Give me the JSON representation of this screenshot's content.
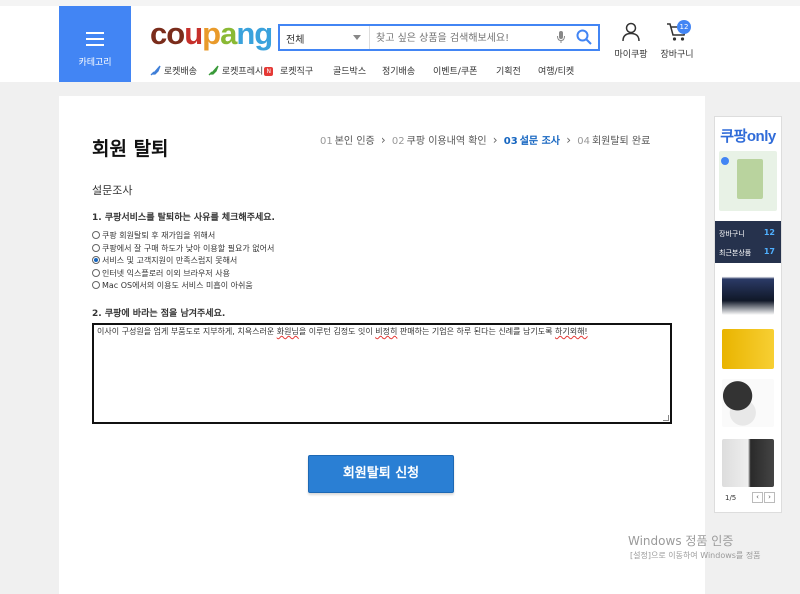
{
  "header": {
    "category_label": "카테고리",
    "logo": {
      "p1": "co",
      "p2": "u",
      "p3": "p",
      "p4": "a",
      "p5": "ng"
    },
    "search": {
      "category": "전체",
      "placeholder": "찾고 싶은 상품을 검색해보세요!"
    },
    "my_coupang": "마이쿠팡",
    "cart": "장바구니",
    "cart_count": "12",
    "nav": [
      "로켓배송",
      "로켓프레시",
      "로켓직구",
      "골드박스",
      "정기배송",
      "이벤트/쿠폰",
      "기획전",
      "여행/티켓"
    ],
    "nav_new_badge": "N"
  },
  "main": {
    "title": "회원 탈퇴",
    "steps": [
      {
        "num": "01",
        "label": "본인 인증"
      },
      {
        "num": "02",
        "label": "쿠팡 이용내역 확인"
      },
      {
        "num": "03",
        "label": "설문 조사"
      },
      {
        "num": "04",
        "label": "회원탈퇴 완료"
      }
    ],
    "active_step": 3,
    "section_label": "설문조사",
    "question1": "1. 쿠팡서비스를 탈퇴하는 사유를 체크해주세요.",
    "options": [
      {
        "label": "쿠팡 회원탈퇴 후 재가입을 위해서",
        "checked": false
      },
      {
        "label": "쿠팡에서 잘 구매 하도가 낮아 이용할 필요가 없어서",
        "checked": false
      },
      {
        "label": "서비스 및 고객지원이 만족스럽지 못해서",
        "checked": true
      },
      {
        "label": "인터넷 익스플로러 이외 브라우저 사용",
        "checked": false
      },
      {
        "label": "Mac OS에서의 이용도 서비스 미흡이 아쉬움",
        "checked": false
      }
    ],
    "question2": "2. 쿠팡에 바라는 점을 남겨주세요.",
    "feedback_a": "이사이 구성원을 엄게 부품도로 지부하게, 치욕스러운 ",
    "feedback_b": "화원님",
    "feedback_c": "을 이루턴 김정도 잇이 ",
    "feedback_d": "비정히",
    "feedback_e": " 판매하는 기업은 하루 된다는 신례를 남기도록 ",
    "feedback_f": "하기외해!",
    "submit_label": "회원탈퇴 신청"
  },
  "sidebar": {
    "banner": "쿠팡only",
    "cart_label": "장바구니",
    "cart_count": "12",
    "recent_label": "최근본상품",
    "recent_count": "17",
    "pager": "1/5",
    "prev": "‹",
    "next": "›"
  },
  "watermark": {
    "line1": "Windows 정품 인증",
    "line2": "[설정]으로 이동하여 Windows를 정품"
  },
  "colors": {
    "accent": "#4285f4",
    "submit": "#2a7fd4",
    "active_step": "#1565c0"
  }
}
